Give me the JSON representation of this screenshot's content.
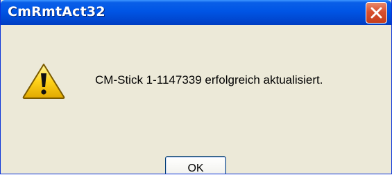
{
  "window": {
    "title": "CmRmtAct32",
    "accent_color": "#0055e5",
    "close_button_color": "#d8502f"
  },
  "dialog": {
    "icon": "warning-icon",
    "message": "CM-Stick 1-1147339 erfolgreich aktualisiert.",
    "ok_label": "OK"
  }
}
